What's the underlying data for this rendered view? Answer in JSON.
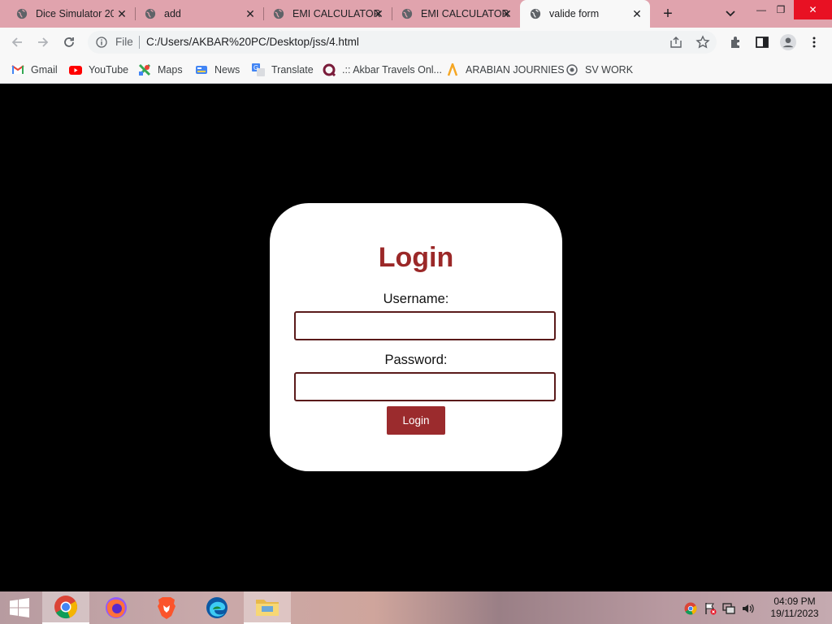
{
  "tabs": [
    {
      "label": "Dice Simulator 20",
      "icon": "globe-icon",
      "active": false
    },
    {
      "label": "add",
      "icon": "globe-icon",
      "active": false
    },
    {
      "label": "EMI CALCULATOR",
      "icon": "globe-icon",
      "active": false
    },
    {
      "label": "EMI CALCULATOR",
      "icon": "globe-icon",
      "active": false
    },
    {
      "label": "valide form",
      "icon": "globe-icon",
      "active": true
    }
  ],
  "window": {
    "minimize": "—",
    "restore": "❐",
    "close": "✕"
  },
  "toolbar": {
    "file_label": "File",
    "url": "C:/Users/AKBAR%20PC/Desktop/jss/4.html"
  },
  "bookmarks": [
    {
      "label": "Gmail",
      "icon": "gmail-icon"
    },
    {
      "label": "YouTube",
      "icon": "youtube-icon"
    },
    {
      "label": "Maps",
      "icon": "maps-icon"
    },
    {
      "label": "News",
      "icon": "news-icon"
    },
    {
      "label": "Translate",
      "icon": "translate-icon"
    },
    {
      "label": ".:: Akbar Travels Onl...",
      "icon": "akbar-travels-icon"
    },
    {
      "label": "ARABIAN JOURNIES",
      "icon": "arabian-journies-icon"
    },
    {
      "label": "SV WORK",
      "icon": "sv-work-icon"
    }
  ],
  "login": {
    "title": "Login",
    "username_label": "Username:",
    "username_value": "",
    "password_label": "Password:",
    "password_value": "",
    "button_label": "Login"
  },
  "colors": {
    "accent": "#9b2828",
    "button": "#9b2b2d",
    "field_border": "#5a1a1a"
  },
  "taskbar": {
    "time": "04:09 PM",
    "date": "19/11/2023"
  }
}
